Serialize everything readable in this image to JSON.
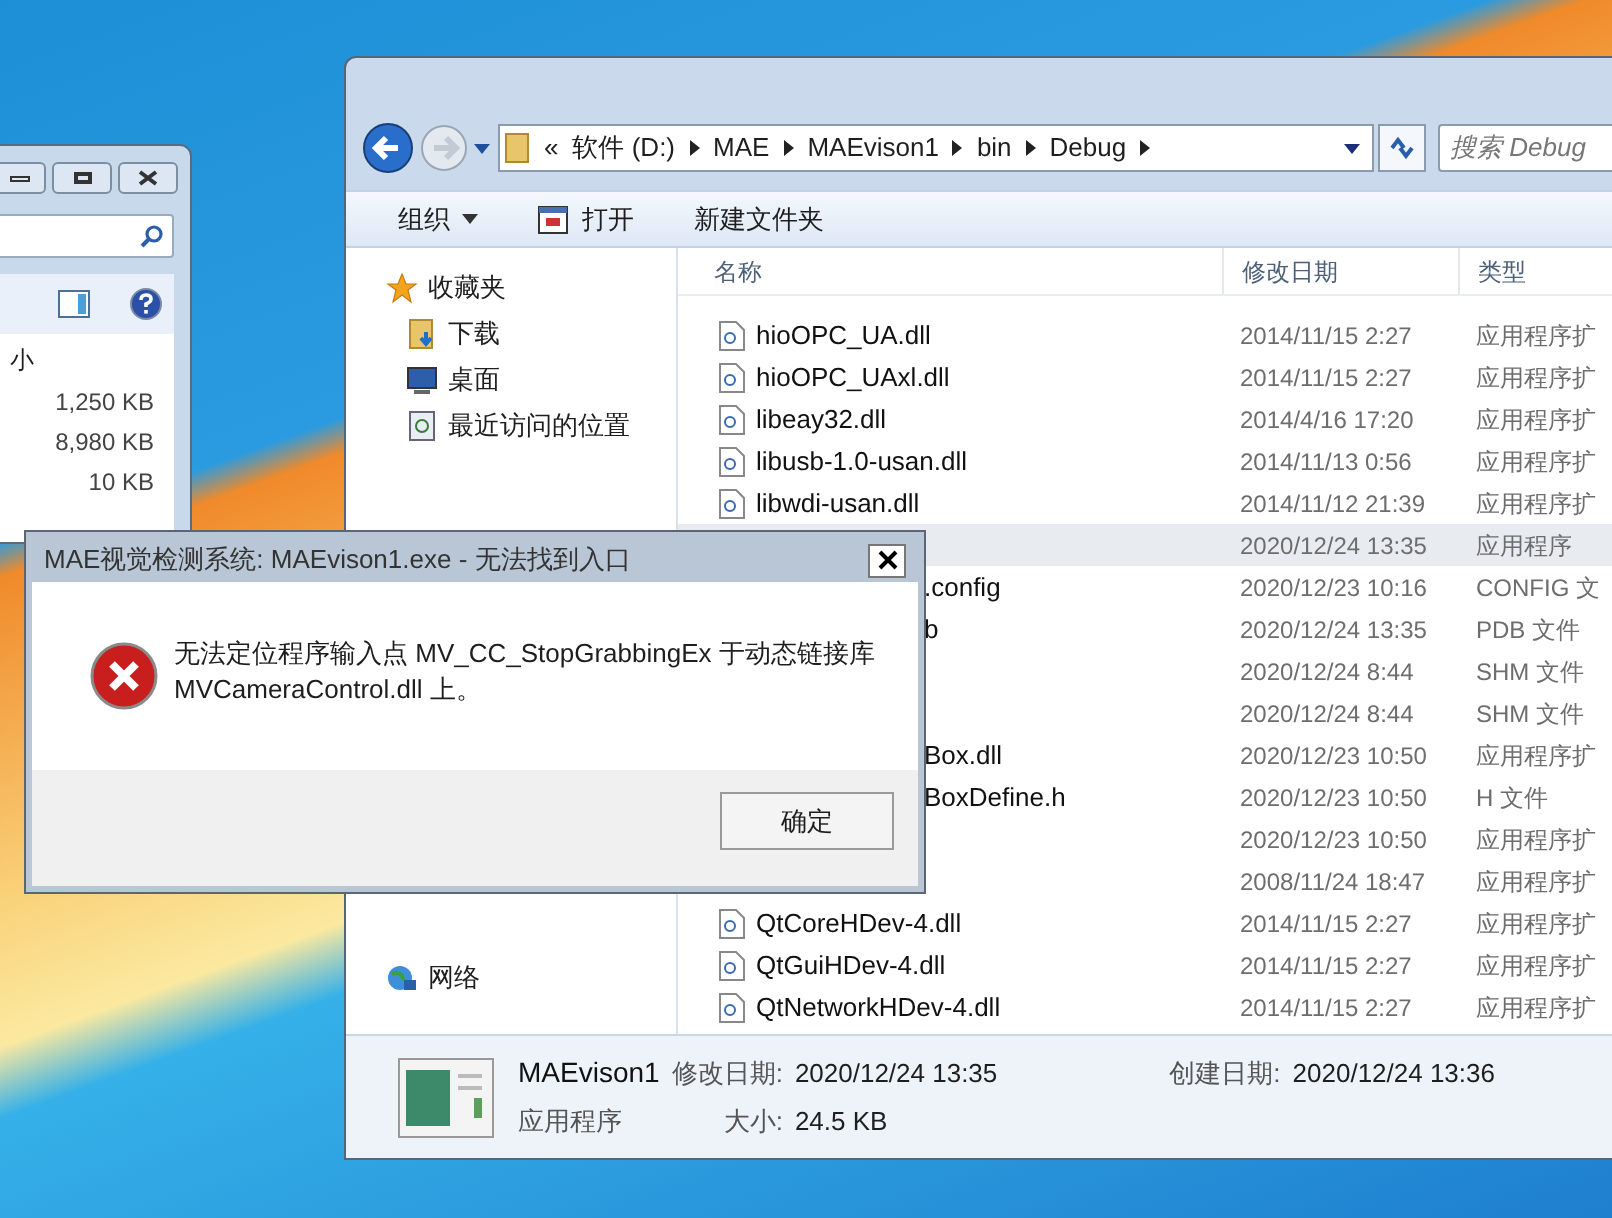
{
  "back_window": {
    "column_header": "小",
    "sizes": [
      "1,250 KB",
      "8,980 KB",
      "10 KB"
    ]
  },
  "explorer": {
    "address": {
      "overflow": "«",
      "segments": [
        "软件 (D:)",
        "MAE",
        "MAEvison1",
        "bin",
        "Debug"
      ]
    },
    "search": {
      "placeholder": "搜索 Debug"
    },
    "toolbar": [
      {
        "kind": "menu",
        "label": "组织"
      },
      {
        "kind": "icon",
        "label": "打开"
      },
      {
        "kind": "plain",
        "label": "新建文件夹"
      }
    ],
    "sidebar": [
      {
        "kind": "favorites",
        "label": "收藏夹",
        "children": [
          {
            "kind": "downloads",
            "label": "下载"
          },
          {
            "kind": "desktop",
            "label": "桌面"
          },
          {
            "kind": "recent",
            "label": "最近访问的位置"
          }
        ]
      },
      {
        "kind": "network",
        "label": "网络"
      }
    ],
    "columns": [
      "名称",
      "修改日期",
      "类型"
    ],
    "rows": [
      {
        "kind": "file",
        "name": "hioOPC_UA.dll",
        "date": "2014/11/15 2:27",
        "type": "应用程序扩",
        "selected": false
      },
      {
        "kind": "file",
        "name": "hioOPC_UAxl.dll",
        "date": "2014/11/15 2:27",
        "type": "应用程序扩",
        "selected": false
      },
      {
        "kind": "file",
        "name": "libeay32.dll",
        "date": "2014/4/16 17:20",
        "type": "应用程序扩",
        "selected": false
      },
      {
        "kind": "file",
        "name": "libusb-1.0-usan.dll",
        "date": "2014/11/13 0:56",
        "type": "应用程序扩",
        "selected": false
      },
      {
        "kind": "file",
        "name": "libwdi-usan.dll",
        "date": "2014/11/12 21:39",
        "type": "应用程序扩",
        "selected": false
      },
      {
        "kind": "covered",
        "name": "",
        "date": "2020/12/24 13:35",
        "type": "应用程序",
        "selected": true
      },
      {
        "kind": "covered",
        "name": ".config",
        "date": "2020/12/23 10:16",
        "type": "CONFIG 文",
        "selected": false
      },
      {
        "kind": "covered",
        "name": "b",
        "date": "2020/12/24 13:35",
        "type": "PDB 文件",
        "selected": false
      },
      {
        "kind": "covered",
        "name": "",
        "date": "2020/12/24 8:44",
        "type": "SHM 文件",
        "selected": false
      },
      {
        "kind": "covered",
        "name": "",
        "date": "2020/12/24 8:44",
        "type": "SHM 文件",
        "selected": false
      },
      {
        "kind": "covered",
        "name": "Box.dll",
        "date": "2020/12/23 10:50",
        "type": "应用程序扩",
        "selected": false
      },
      {
        "kind": "covered",
        "name": "BoxDefine.h",
        "date": "2020/12/23 10:50",
        "type": "H 文件",
        "selected": false
      },
      {
        "kind": "covered",
        "name": "",
        "date": "2020/12/23 10:50",
        "type": "应用程序扩",
        "selected": false
      },
      {
        "kind": "covered",
        "name": "",
        "date": "2008/11/24 18:47",
        "type": "应用程序扩",
        "selected": false
      },
      {
        "kind": "file",
        "name": "QtCoreHDev-4.dll",
        "date": "2014/11/15 2:27",
        "type": "应用程序扩",
        "selected": false
      },
      {
        "kind": "file",
        "name": "QtGuiHDev-4.dll",
        "date": "2014/11/15 2:27",
        "type": "应用程序扩",
        "selected": false
      },
      {
        "kind": "file",
        "name": "QtNetworkHDev-4.dll",
        "date": "2014/11/15 2:27",
        "type": "应用程序扩",
        "selected": false
      }
    ],
    "details": {
      "name": "MAEvison1",
      "kind_label": "应用程序",
      "modified_label": "修改日期:",
      "modified": "2020/12/24 13:35",
      "created_label": "创建日期:",
      "created": "2020/12/24 13:36",
      "size_label": "大小:",
      "size": "24.5 KB"
    }
  },
  "dialog": {
    "title": "MAE视觉检测系统: MAEvison1.exe - 无法找到入口",
    "message": "无法定位程序输入点 MV_CC_StopGrabbingEx 于动态链接库 MVCameraControl.dll 上。",
    "button": "确定"
  }
}
